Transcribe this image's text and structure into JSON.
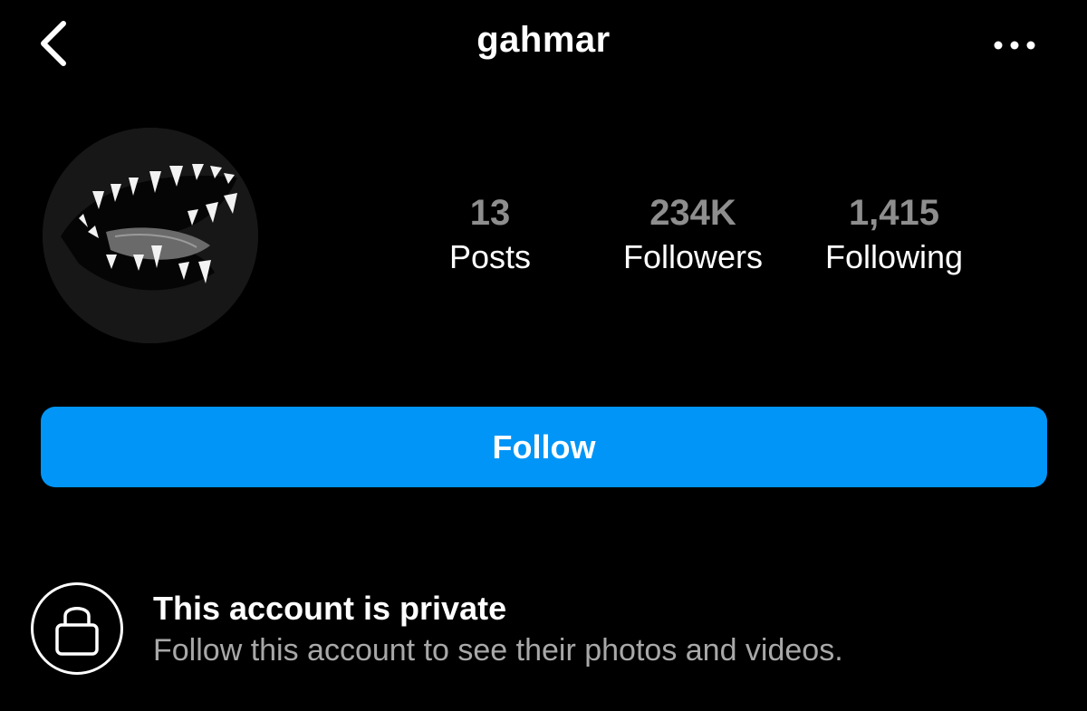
{
  "header": {
    "title": "gahmar",
    "back_icon": "chevron-left-icon",
    "more_icon": "more-horizontal-icon"
  },
  "profile": {
    "avatar_icon": "wolf-teeth-avatar"
  },
  "stats": [
    {
      "value": "13",
      "label": "Posts"
    },
    {
      "value": "234K",
      "label": "Followers"
    },
    {
      "value": "1,415",
      "label": "Following"
    }
  ],
  "follow_button": {
    "label": "Follow",
    "color": "#0095f6"
  },
  "private_notice": {
    "icon": "lock-icon",
    "title": "This account is private",
    "subtitle": "Follow this account to see their photos and videos."
  }
}
